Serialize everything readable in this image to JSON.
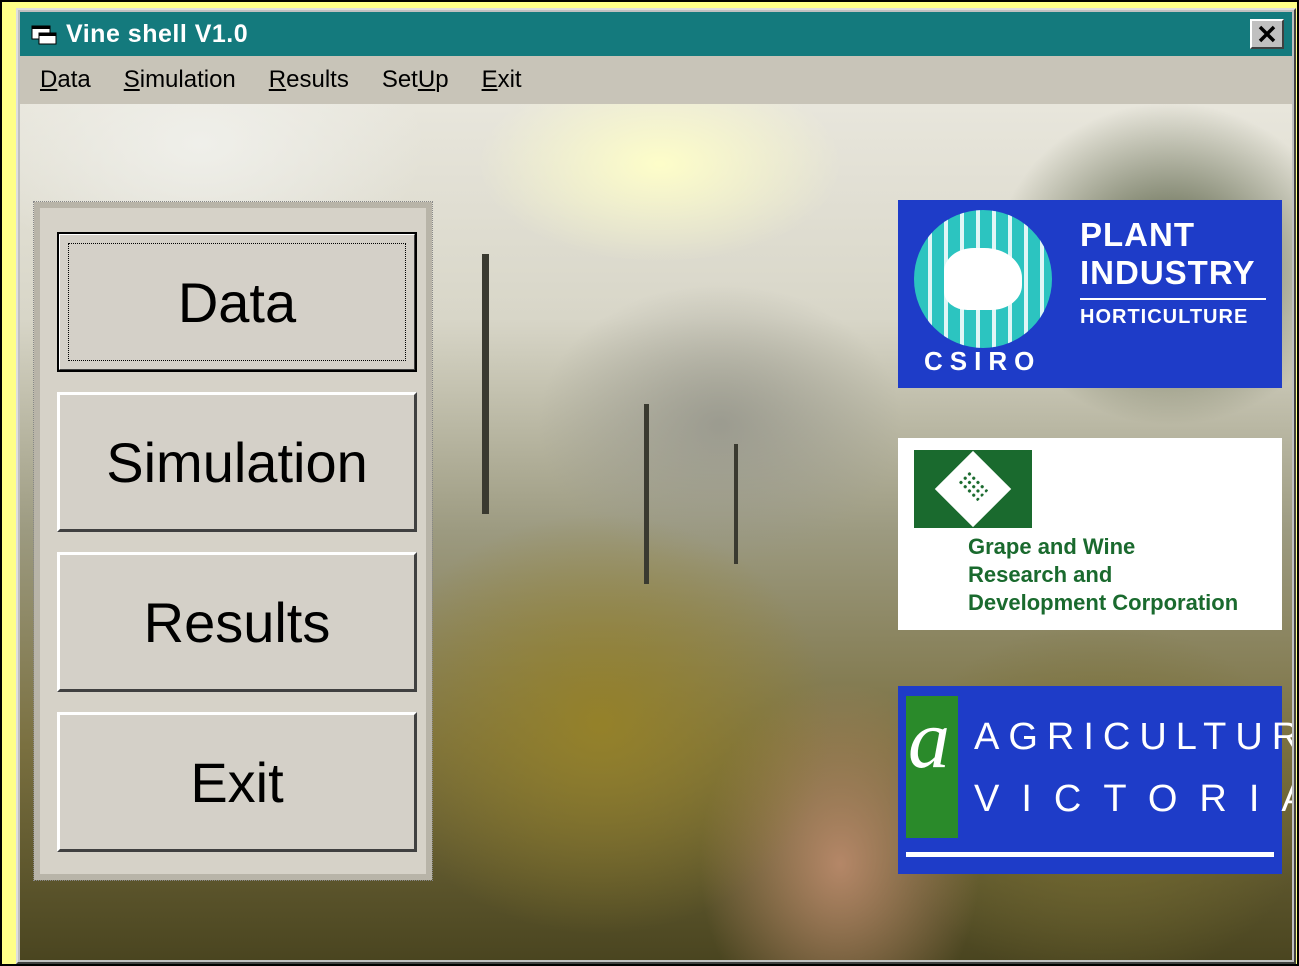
{
  "window": {
    "title": "Vine shell V1.0",
    "close_label": "✕"
  },
  "menu": {
    "items": [
      {
        "first": "D",
        "rest": "ata"
      },
      {
        "first": "S",
        "rest": "imulation"
      },
      {
        "first": "R",
        "rest": "esults"
      },
      {
        "pre": "Set",
        "first": "U",
        "rest": "p"
      },
      {
        "first": "E",
        "rest": "xit"
      }
    ]
  },
  "buttons": {
    "data": "Data",
    "simulation": "Simulation",
    "results": "Results",
    "exit": "Exit"
  },
  "logos": {
    "csiro": {
      "word": "CSIRO",
      "line1": "PLANT",
      "line2": "INDUSTRY",
      "line3": "HORTICULTURE"
    },
    "gwrdc": {
      "line1": "Grape and Wine",
      "line2": "Research and",
      "line3": "Development Corporation"
    },
    "agvic": {
      "letter": "a",
      "line1": "AGRICULTURE",
      "line2": "VICTORIA"
    }
  },
  "colors": {
    "titlebar": "#147a7d",
    "csiro_blue": "#1e3cc8",
    "gwrdc_green": "#1a6a2e",
    "outer_frame": "#FFFF88"
  }
}
